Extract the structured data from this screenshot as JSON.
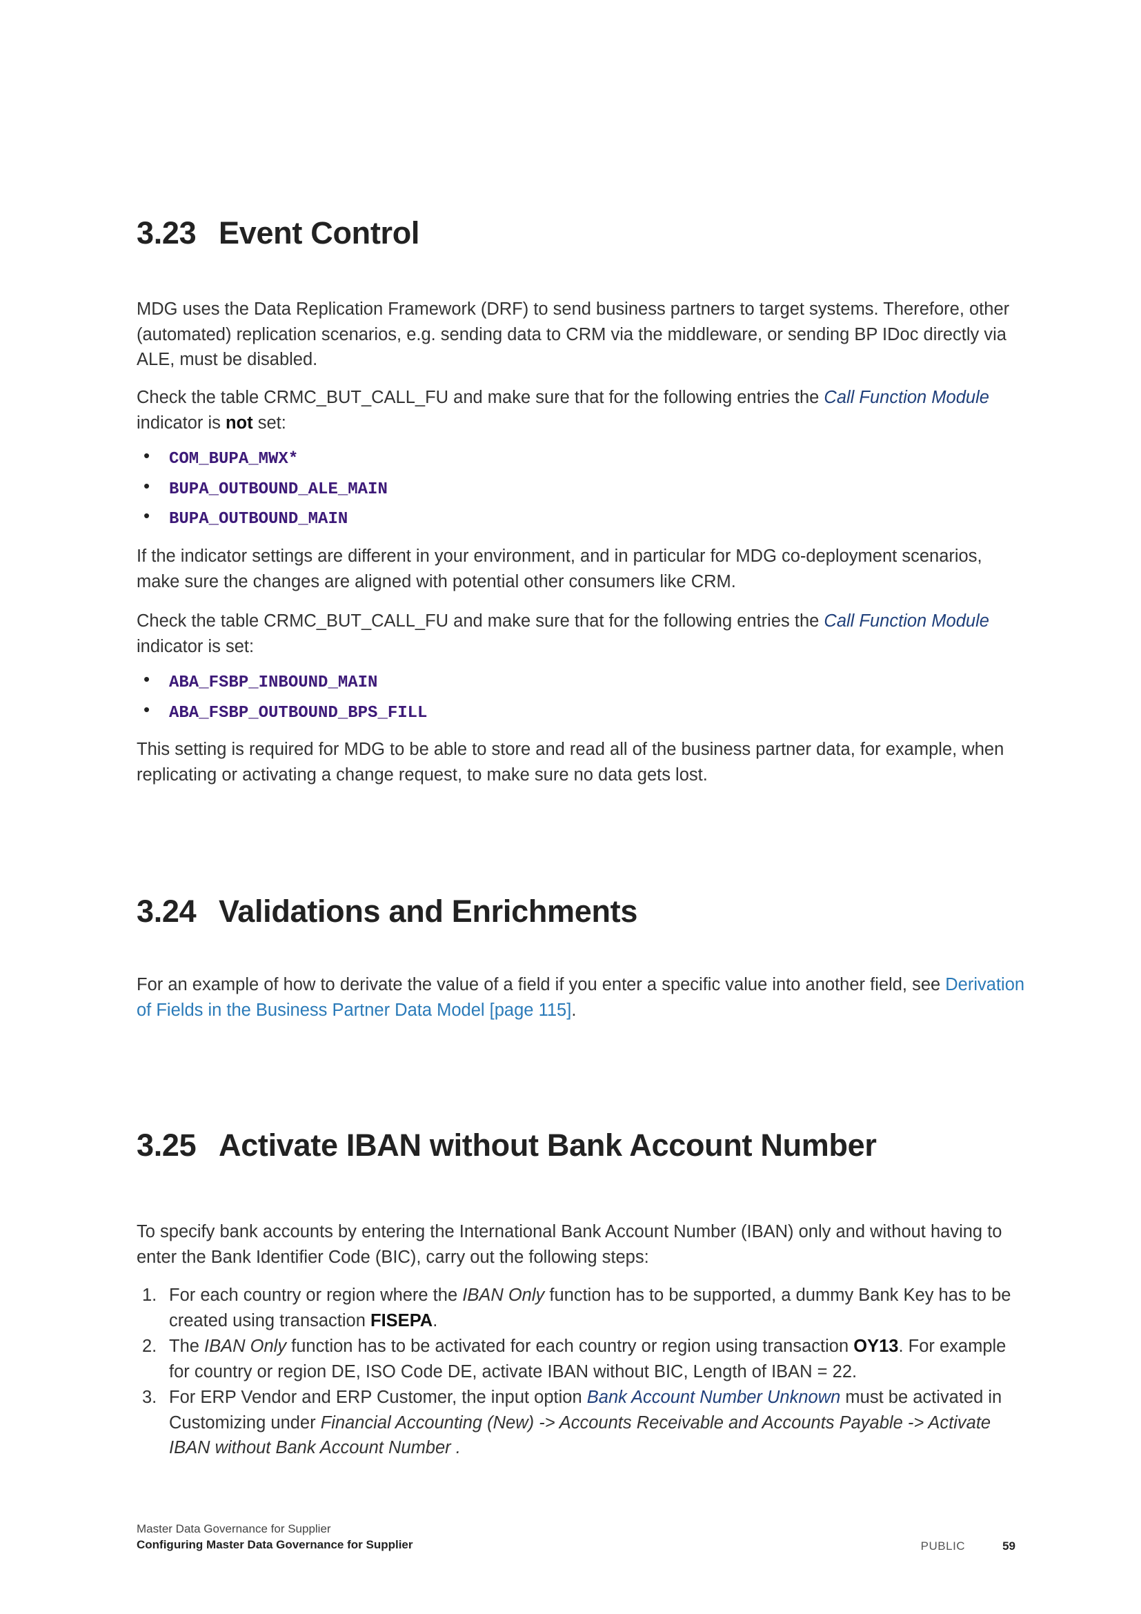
{
  "sections": [
    {
      "num": "3.23",
      "title": "Event Control"
    },
    {
      "num": "3.24",
      "title": "Validations and Enrichments"
    },
    {
      "num": "3.25",
      "title": "Activate IBAN without Bank Account Number"
    }
  ],
  "s323": {
    "p1": "MDG uses the Data Replication Framework (DRF) to send business partners to target systems. Therefore, other (automated) replication scenarios, e.g. sending data to CRM via the middleware, or sending BP IDoc directly via ALE, must be disabled.",
    "p2_a": "Check the table CRMC_BUT_CALL_FU and make sure that for the following entries the ",
    "p2_link": "Call Function Module",
    "p2_b": " indicator is ",
    "p2_bold": "not",
    "p2_c": " set:",
    "list1": [
      "COM_BUPA_MWX*",
      "BUPA_OUTBOUND_ALE_MAIN",
      "BUPA_OUTBOUND_MAIN"
    ],
    "p3": "If the indicator settings are different in your environment, and in particular for MDG co-deployment scenarios, make sure the changes are aligned with potential other consumers like CRM.",
    "p4_a": "Check the table CRMC_BUT_CALL_FU and make sure that for the following entries the ",
    "p4_link": "Call Function Module",
    "p4_b": " indicator is set:",
    "list2": [
      "ABA_FSBP_INBOUND_MAIN",
      "ABA_FSBP_OUTBOUND_BPS_FILL"
    ],
    "p5": "This setting is required for MDG to be able to store and read all of the business partner data, for example, when replicating or activating a change request, to make sure no data gets lost."
  },
  "s324": {
    "p1": "For an example of how to derivate the value of a field if you enter a specific value into another field, see ",
    "link": "Derivation of Fields in the Business Partner Data Model [page 115]",
    "end": "."
  },
  "s325": {
    "intro": "To specify bank accounts by entering the International Bank Account Number (IBAN) only and without having to enter the Bank Identifier Code (BIC), carry out the following steps:",
    "step1": {
      "n": "1.",
      "a": "For each country or region where the ",
      "i": "IBAN Only",
      "b": " function has to be supported, a dummy Bank Key has to be created using transaction ",
      "bold": "FISEPA",
      "c": "."
    },
    "step2": {
      "n": "2.",
      "a": "The ",
      "i": "IBAN Only",
      "b": " function has to be activated for each country or region using transaction ",
      "bold": "OY13",
      "c": ". For example for country or region DE, ISO Code DE, activate IBAN without BIC, Length of IBAN = 22."
    },
    "step3": {
      "n": "3.",
      "a": "For ERP Vendor and ERP Customer, the input option ",
      "link": "Bank Account Number Unknown",
      "b": " must be activated in Customizing under ",
      "i": "Financial Accounting (New) -> Accounts Receivable and Accounts Payable -> Activate IBAN without Bank Account Number",
      "c": " ."
    }
  },
  "footer": {
    "doc_title": "Master Data Governance for Supplier",
    "chapter": "Configuring Master Data Governance for Supplier",
    "classification": "PUBLIC",
    "page": "59"
  }
}
